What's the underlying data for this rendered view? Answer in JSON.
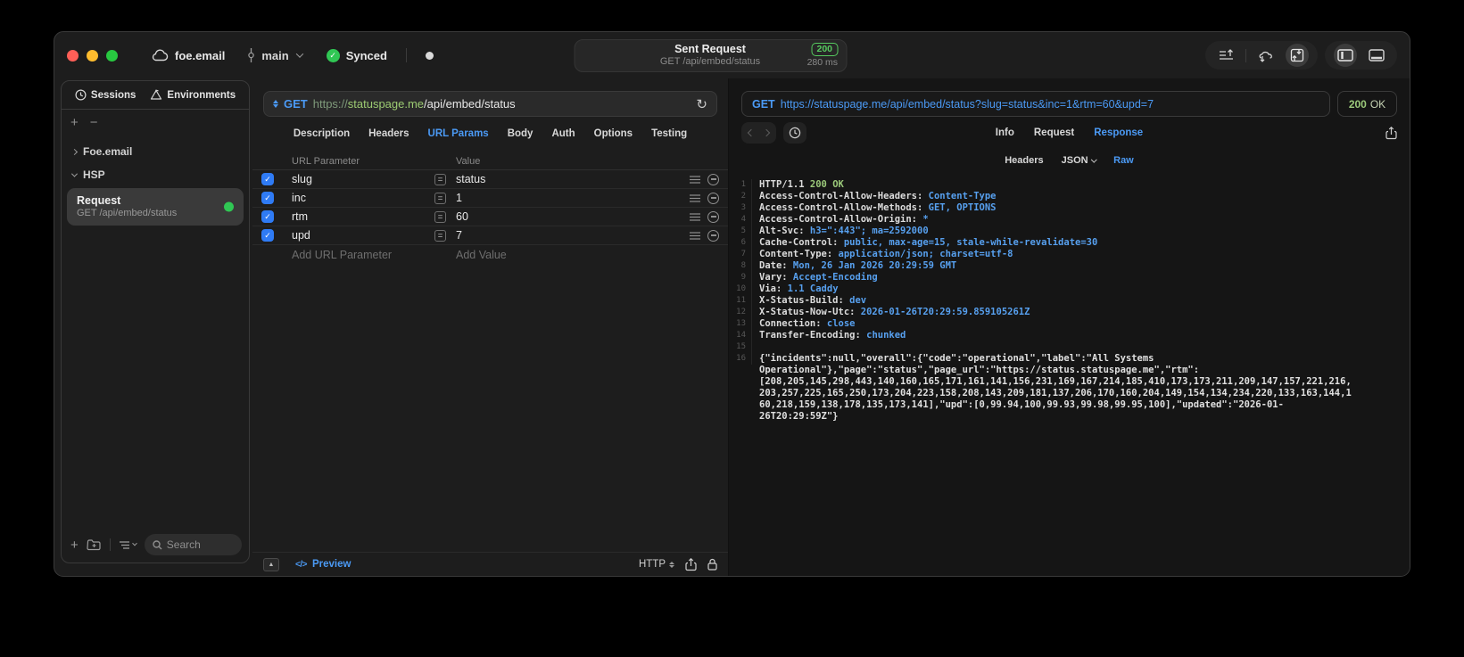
{
  "colors": {
    "accent": "#4b9af5",
    "green": "#30c754",
    "badgeGreen": "#56c95f",
    "codeGreen": "#9bc97a",
    "headerBlue": "#57a0ef",
    "checkboxBlue": "#2f7bf5",
    "schemeGreen": "#7e997a",
    "hostGreen": "#9ccb72",
    "trafficRed": "#ff5f57",
    "trafficYellow": "#febc2e",
    "trafficGreen": "#28c840"
  },
  "titlebar": {
    "project": "foe.email",
    "branch": "main",
    "sync_status": "Synced",
    "request_pill": {
      "title": "Sent Request",
      "subtitle": "GET /api/embed/status",
      "status_code": "200",
      "duration": "280 ms"
    }
  },
  "sidebar": {
    "tabs": [
      {
        "label": "Sessions",
        "icon": "history-clock-icon"
      },
      {
        "label": "Environments",
        "icon": "environments-icon"
      }
    ],
    "tree": [
      {
        "label": "Foe.email",
        "state": "collapsed"
      },
      {
        "label": "HSP",
        "state": "expanded"
      }
    ],
    "selected_request": {
      "title": "Request",
      "subtitle": "GET /api/embed/status"
    },
    "search_placeholder": "Search"
  },
  "request_pane": {
    "method": "GET",
    "url_scheme": "https://",
    "url_host": "statuspage.me",
    "url_path": "/api/embed/status",
    "tabs": [
      "Description",
      "Headers",
      "URL Params",
      "Body",
      "Auth",
      "Options",
      "Testing"
    ],
    "active_tab": "URL Params",
    "param_table": {
      "columns": [
        "URL Parameter",
        "Value"
      ],
      "rows": [
        {
          "name": "slug",
          "value": "status",
          "enabled": true
        },
        {
          "name": "inc",
          "value": "1",
          "enabled": true
        },
        {
          "name": "rtm",
          "value": "60",
          "enabled": true
        },
        {
          "name": "upd",
          "value": "7",
          "enabled": true
        }
      ],
      "add_param_placeholder": "Add URL Parameter",
      "add_value_placeholder": "Add Value"
    },
    "footer": {
      "preview_label": "Preview",
      "code_glyph": "</>",
      "protocol": "HTTP"
    }
  },
  "response_pane": {
    "request_line": {
      "method": "GET",
      "url": "https://statuspage.me/api/embed/status?slug=status&inc=1&rtm=60&upd=7"
    },
    "status": {
      "code": "200",
      "text": "OK"
    },
    "tabs": [
      "Info",
      "Request",
      "Response"
    ],
    "active_tab": "Response",
    "subtabs": [
      "Headers",
      "JSON",
      "Raw"
    ],
    "active_subtab": "Raw",
    "body_lines": [
      {
        "num": "1",
        "parts": [
          {
            "t": "HTTP/1.1 ",
            "c": "k"
          },
          {
            "t": "200 OK",
            "c": "g"
          }
        ]
      },
      {
        "num": "2",
        "parts": [
          {
            "t": "Access-Control-Allow-Headers:",
            "c": "k"
          },
          {
            "t": " Content-Type",
            "c": "v"
          }
        ]
      },
      {
        "num": "3",
        "parts": [
          {
            "t": "Access-Control-Allow-Methods:",
            "c": "k"
          },
          {
            "t": " GET, OPTIONS",
            "c": "v"
          }
        ]
      },
      {
        "num": "4",
        "parts": [
          {
            "t": "Access-Control-Allow-Origin:",
            "c": "k"
          },
          {
            "t": " *",
            "c": "v"
          }
        ]
      },
      {
        "num": "5",
        "parts": [
          {
            "t": "Alt-Svc:",
            "c": "k"
          },
          {
            "t": " h3=\":443\"; ma=2592000",
            "c": "v"
          }
        ]
      },
      {
        "num": "6",
        "parts": [
          {
            "t": "Cache-Control:",
            "c": "k"
          },
          {
            "t": " public, max-age=15, stale-while-revalidate=30",
            "c": "v"
          }
        ]
      },
      {
        "num": "7",
        "parts": [
          {
            "t": "Content-Type:",
            "c": "k"
          },
          {
            "t": " application/json; charset=utf-8",
            "c": "v"
          }
        ]
      },
      {
        "num": "8",
        "parts": [
          {
            "t": "Date:",
            "c": "k"
          },
          {
            "t": " Mon, 26 Jan 2026 20:29:59 GMT",
            "c": "v"
          }
        ]
      },
      {
        "num": "9",
        "parts": [
          {
            "t": "Vary:",
            "c": "k"
          },
          {
            "t": " Accept-Encoding",
            "c": "v"
          }
        ]
      },
      {
        "num": "10",
        "parts": [
          {
            "t": "Via:",
            "c": "k"
          },
          {
            "t": " 1.1 Caddy",
            "c": "v"
          }
        ]
      },
      {
        "num": "11",
        "parts": [
          {
            "t": "X-Status-Build:",
            "c": "k"
          },
          {
            "t": " dev",
            "c": "v"
          }
        ]
      },
      {
        "num": "12",
        "parts": [
          {
            "t": "X-Status-Now-Utc:",
            "c": "k"
          },
          {
            "t": " 2026-01-26T20:29:59.859105261Z",
            "c": "v"
          }
        ]
      },
      {
        "num": "13",
        "parts": [
          {
            "t": "Connection:",
            "c": "k"
          },
          {
            "t": " close",
            "c": "v"
          }
        ]
      },
      {
        "num": "14",
        "parts": [
          {
            "t": "Transfer-Encoding:",
            "c": "k"
          },
          {
            "t": " chunked",
            "c": "v"
          }
        ]
      },
      {
        "num": "15",
        "parts": []
      },
      {
        "num": "16",
        "parts": [
          {
            "t": "{\"incidents\":null,\"overall\":{\"code\":\"operational\",\"label\":\"All Systems Operational\"},\"page\":\"status\",\"page_url\":\"https://status.statuspage.me\",\"rtm\":[208,205,145,298,443,140,160,165,171,161,141,156,231,169,167,214,185,410,173,173,211,209,147,157,221,216,203,257,225,165,250,173,204,223,158,208,143,209,181,137,206,170,160,204,149,154,134,234,220,133,163,144,160,218,159,138,178,135,173,141],\"upd\":[0,99.94,100,99.93,99.98,99.95,100],\"updated\":\"2026-01-26T20:29:59Z\"}",
            "c": "b"
          }
        ]
      }
    ]
  }
}
